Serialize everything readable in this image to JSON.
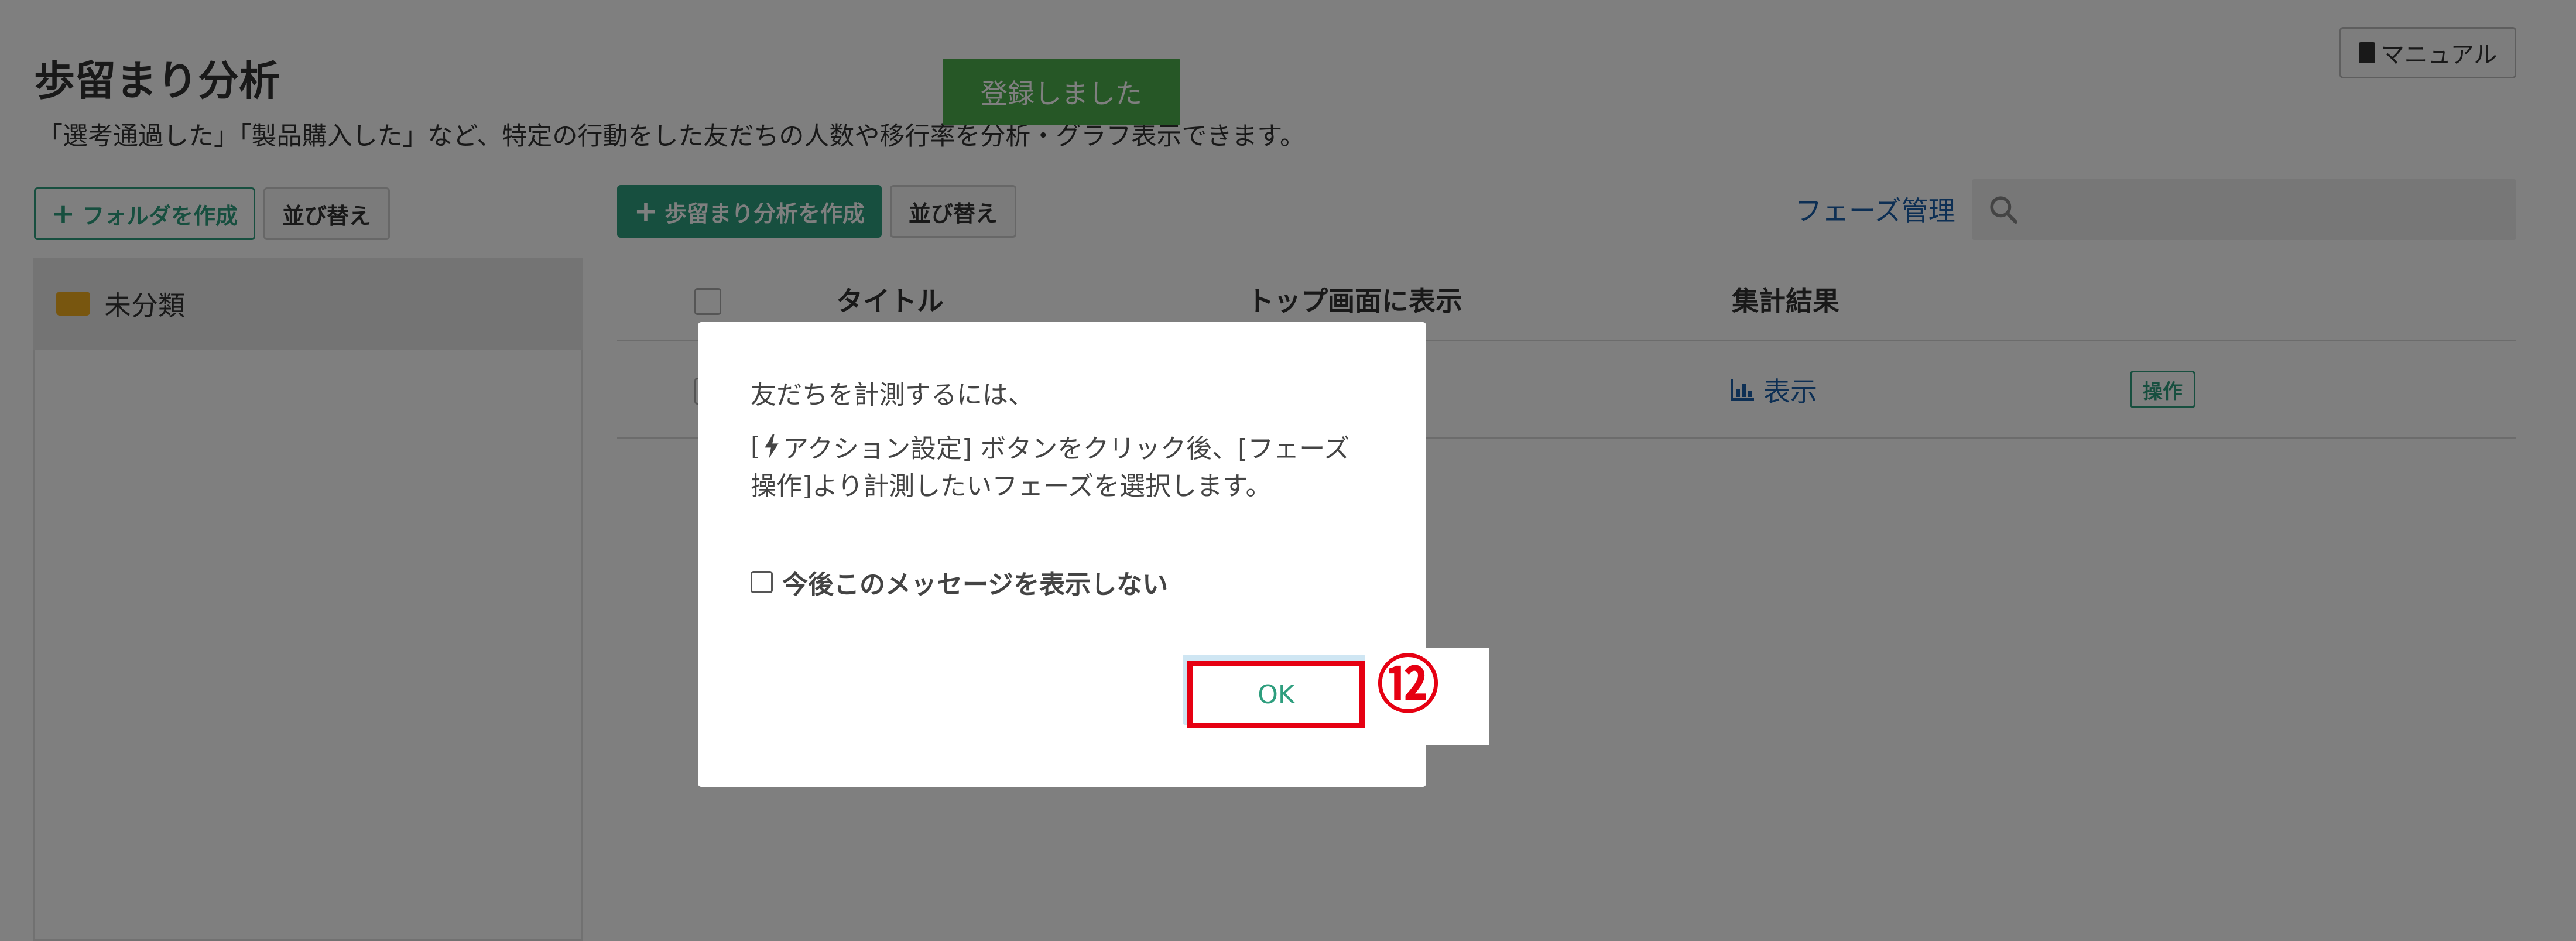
{
  "page": {
    "title": "歩留まり分析",
    "description": "「選考通過した」「製品購入した」など、特定の行動をした友だちの人数や移行率を分析・グラフ表示できます。",
    "manual_label": "マニュアル"
  },
  "toast": {
    "text": "登録しました"
  },
  "folder_panel": {
    "create_folder_label": "フォルダを作成",
    "sort_label": "並び替え",
    "folders": [
      {
        "label": "未分類"
      }
    ]
  },
  "main": {
    "create_label": "歩留まり分析を作成",
    "sort_label": "並び替え",
    "phase_link": "フェーズ管理",
    "search_placeholder": "",
    "columns": {
      "title": "タイトル",
      "top_display": "トップ画面に表示",
      "result": "集計結果"
    },
    "row": {
      "result_label": "表示",
      "action_label": "操作"
    }
  },
  "dialog": {
    "line1": "友だちを計測するには、",
    "line2a_prefix": "[",
    "line2a_suffix": " アクション設定] ボタンをクリック後、[フェーズ",
    "line2b": "操作]より計測したいフェーズを選択します。",
    "checkbox_label": "今後このメッセージを表示しない",
    "ok_label": "OK"
  },
  "annotation": {
    "step_marker": "⑫"
  },
  "colors": {
    "accent": "#2e9e7e",
    "link": "#1a5fa8",
    "toast": "#4cae4c",
    "highlight": "#e60012"
  }
}
